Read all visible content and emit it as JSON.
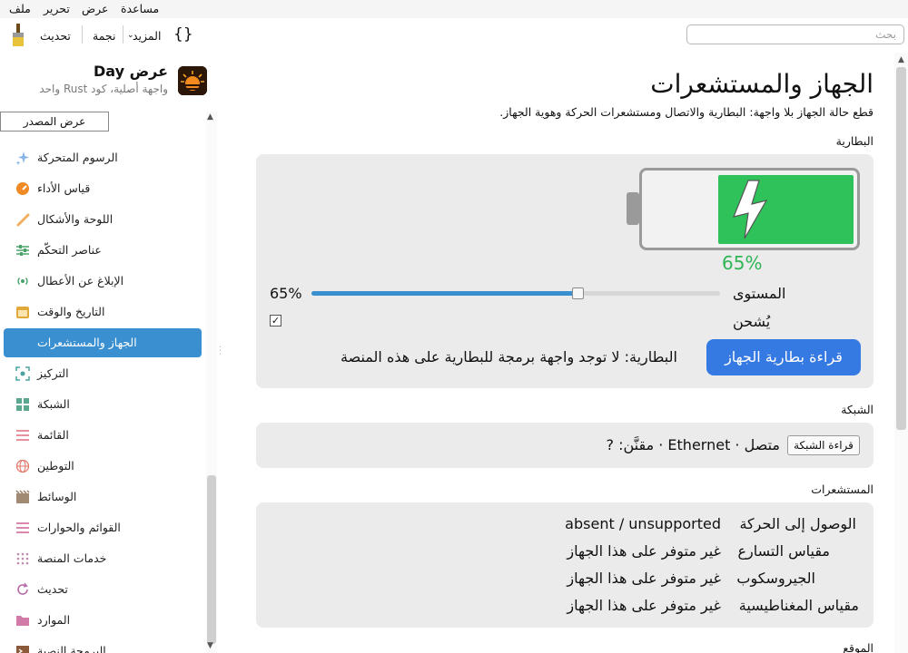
{
  "menu": [
    "ملف",
    "تحرير",
    "عرض",
    "مساعدة"
  ],
  "toolbar": {
    "refresh": "تحديث",
    "star": "نجمة",
    "more": "المزيد",
    "code": "{}"
  },
  "search": {
    "placeholder": "بحث"
  },
  "sidebar": {
    "title": "عرض Day",
    "subtitle": "واجهة أصلية، كود Rust واحد",
    "view_source": "عرض المصدر",
    "items": [
      {
        "label": "الرسوم المتحركة",
        "icon": "sparkles-icon"
      },
      {
        "label": "قياس الأداء",
        "icon": "gauge-icon"
      },
      {
        "label": "اللوحة والأشكال",
        "icon": "brush-icon"
      },
      {
        "label": "عناصر التحكّم",
        "icon": "sliders-icon"
      },
      {
        "label": "الإبلاغ عن الأعطال",
        "icon": "broadcast-icon"
      },
      {
        "label": "التاريخ والوقت",
        "icon": "calendar-icon"
      },
      {
        "label": "الجهاز والمستشعرات",
        "icon": "device-icon",
        "active": true
      },
      {
        "label": "التركيز",
        "icon": "focus-icon"
      },
      {
        "label": "الشبكة",
        "icon": "grid-icon"
      },
      {
        "label": "القائمة",
        "icon": "list-icon"
      },
      {
        "label": "التوطين",
        "icon": "globe-icon"
      },
      {
        "label": "الوسائط",
        "icon": "film-icon"
      },
      {
        "label": "القوائم والحوارات",
        "icon": "menu-icon"
      },
      {
        "label": "خدمات المنصة",
        "icon": "dots-grid-icon"
      },
      {
        "label": "تحديث",
        "icon": "refresh-icon"
      },
      {
        "label": "الموارد",
        "icon": "folder-icon"
      },
      {
        "label": "البرمجة النصية",
        "icon": "terminal-icon"
      }
    ]
  },
  "main": {
    "title": "الجهاز والمستشعرات",
    "description": "قطع حالة الجهاز بلا واجهة: البطارية والاتصال ومستشعرات الحركة وهوية الجهاز.",
    "battery_section": "البطارية",
    "battery_percent_text": "65%",
    "battery_level": 0.65,
    "level_label": "المستوى",
    "level_value": "65%",
    "charging_label": "يُشحن",
    "charging_checked": true,
    "read_battery_button": "قراءة بطارية الجهاز",
    "battery_status": "البطارية: لا توجد واجهة برمجة للبطارية على هذه المنصة",
    "network_section": "الشبكة",
    "read_network_button": "قراءة الشبكة",
    "network_status": "متصل · Ethernet · مقنَّن: ?",
    "sensors_section": "المستشعرات",
    "sensors": [
      {
        "name": "الوصول إلى الحركة",
        "value": "absent / unsupported"
      },
      {
        "name": "مقياس التسارع",
        "value": "غير متوفر على هذا الجهاز"
      },
      {
        "name": "الجيروسكوب",
        "value": "غير متوفر على هذا الجهاز"
      },
      {
        "name": "مقياس المغناطيسية",
        "value": "غير متوفر على هذا الجهاز"
      }
    ],
    "location_section": "الموقع"
  },
  "colors": {
    "accent": "#3a8fd0",
    "primary_button": "#3579e2",
    "battery_green": "#2fc25b"
  }
}
